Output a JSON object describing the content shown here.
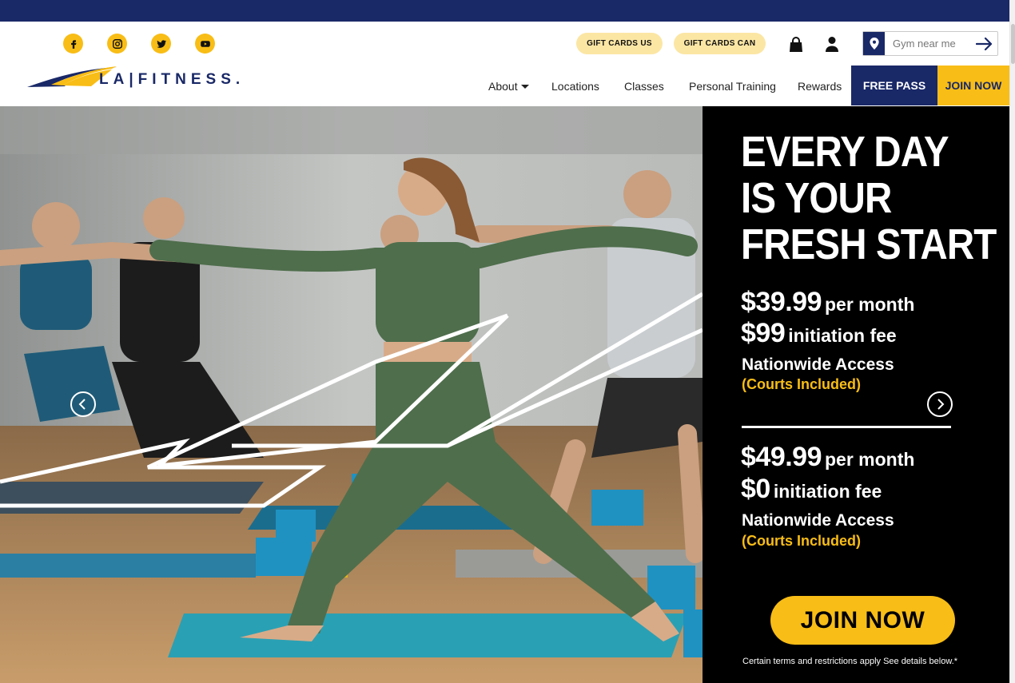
{
  "social": {
    "icons": [
      "facebook-icon",
      "instagram-icon",
      "twitter-icon",
      "youtube-icon"
    ],
    "color": "#f8bd16"
  },
  "header": {
    "gift_us": "GIFT CARDS US",
    "gift_can": "GIFT CARDS CAN",
    "search_placeholder": "Gym near me",
    "logo_text": "LA|FITNESS.",
    "brand_blue": "#192867",
    "brand_yellow": "#f8bd16"
  },
  "nav": {
    "items": [
      "About",
      "Locations",
      "Classes",
      "Personal Training",
      "Rewards"
    ],
    "free_pass": "FREE PASS",
    "join_now": "JOIN NOW"
  },
  "hero": {
    "headline_lines": [
      "EVERY DAY",
      "IS YOUR",
      "FRESH START"
    ],
    "offers": [
      {
        "price": "$39.99",
        "price_unit": "per month",
        "fee": "$99",
        "fee_unit": "initiation fee",
        "access": "Nationwide Access",
        "courts": "(Courts Included)"
      },
      {
        "price": "$49.99",
        "price_unit": "per month",
        "fee": "$0",
        "fee_unit": "initiation fee",
        "access": "Nationwide Access",
        "courts": "(Courts Included)"
      }
    ],
    "cta": "JOIN NOW",
    "terms": "Certain terms and restrictions apply See details below.*"
  }
}
